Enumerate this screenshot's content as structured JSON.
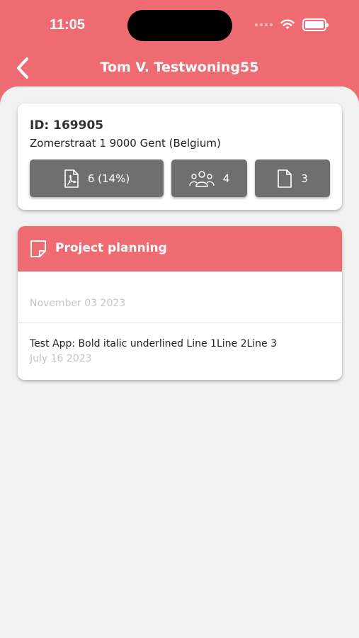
{
  "status_bar": {
    "time": "11:05"
  },
  "nav": {
    "title": "Tom V. Testwoning55"
  },
  "info_card": {
    "id": "ID: 169905",
    "address": "Zomerstraat 1 9000 Gent (Belgium)",
    "stats": [
      {
        "icon": "pdf-document-icon",
        "value": "6 (14%)"
      },
      {
        "icon": "people-icon",
        "value": "4"
      },
      {
        "icon": "document-icon",
        "value": "3"
      }
    ]
  },
  "planning_card": {
    "title": "Project planning",
    "items": [
      {
        "title": "",
        "date": "November 03 2023"
      },
      {
        "title": "Test App: Bold italic underlined Line 1Line 2Line 3",
        "date": "July 16 2023"
      }
    ]
  },
  "colors": {
    "accent": "#ef6b72",
    "stat_button": "#6f6f6f",
    "background": "#f1f1f1"
  }
}
